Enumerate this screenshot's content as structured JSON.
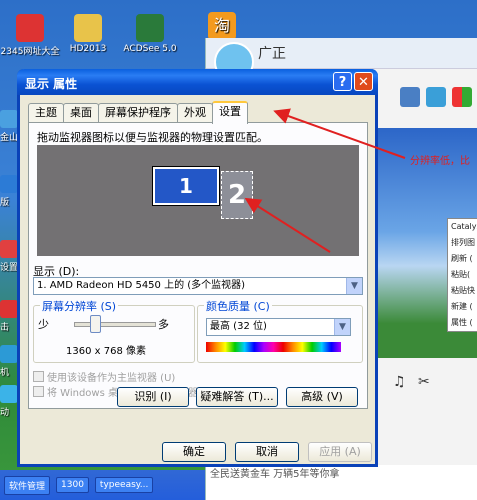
{
  "desktop": {
    "icons": [
      {
        "label": "2345网址大全",
        "color": "#d33"
      },
      {
        "label": "HD2013",
        "color": "#e8c34a"
      },
      {
        "label": "ACDSee 5.0",
        "color": "#2a7a3a"
      },
      {
        "label": "",
        "color": "#f39a1e",
        "glyph": "淘"
      }
    ],
    "left_labels": [
      "金山",
      "版",
      "设置",
      "击",
      "机",
      "动"
    ],
    "taskbar": {
      "items": [
        "软件管理",
        "1300",
        "typeeasy..."
      ]
    }
  },
  "background_app": {
    "title": "广正",
    "context_menu": [
      "Catalys",
      "排列图",
      "刷新 (",
      "粘贴(",
      "粘贴快",
      "新建 (",
      "属性 ("
    ],
    "red_annotation": "分辨率低，比",
    "footer_text": "全民送黄金车 万辆5年等你拿"
  },
  "dialog": {
    "title": "显示 属性",
    "help_label": "?",
    "close_label": "✕",
    "tabs": [
      "主题",
      "桌面",
      "屏幕保护程序",
      "外观",
      "设置"
    ],
    "active_tab": "设置",
    "instruction": "拖动监视器图标以便与监视器的物理设置匹配。",
    "monitor1": "1",
    "monitor2": "2",
    "display_label": "显示 (D):",
    "display_value": "1. AMD Radeon HD 5450 上的 (多个监视器)",
    "resolution": {
      "group_label": "屏幕分辨率 (S)",
      "less": "少",
      "more": "多",
      "value": "1360 x 768 像素",
      "slider_level": 0.25
    },
    "color": {
      "group_label": "颜色质量 (C)",
      "value": "最高 (32 位)"
    },
    "checkbox1": "使用该设备作为主监视器 (U)",
    "checkbox2": "将 Windows 桌面扩展到该监视器上 (E)",
    "buttons": {
      "identify": "识别 (I)",
      "troubleshoot": "疑难解答 (T)...",
      "advanced": "高级 (V)",
      "ok": "确定",
      "cancel": "取消",
      "apply": "应用 (A)"
    }
  },
  "colors": {
    "accent": "#0a52d3",
    "annotation_red": "#e02020"
  }
}
